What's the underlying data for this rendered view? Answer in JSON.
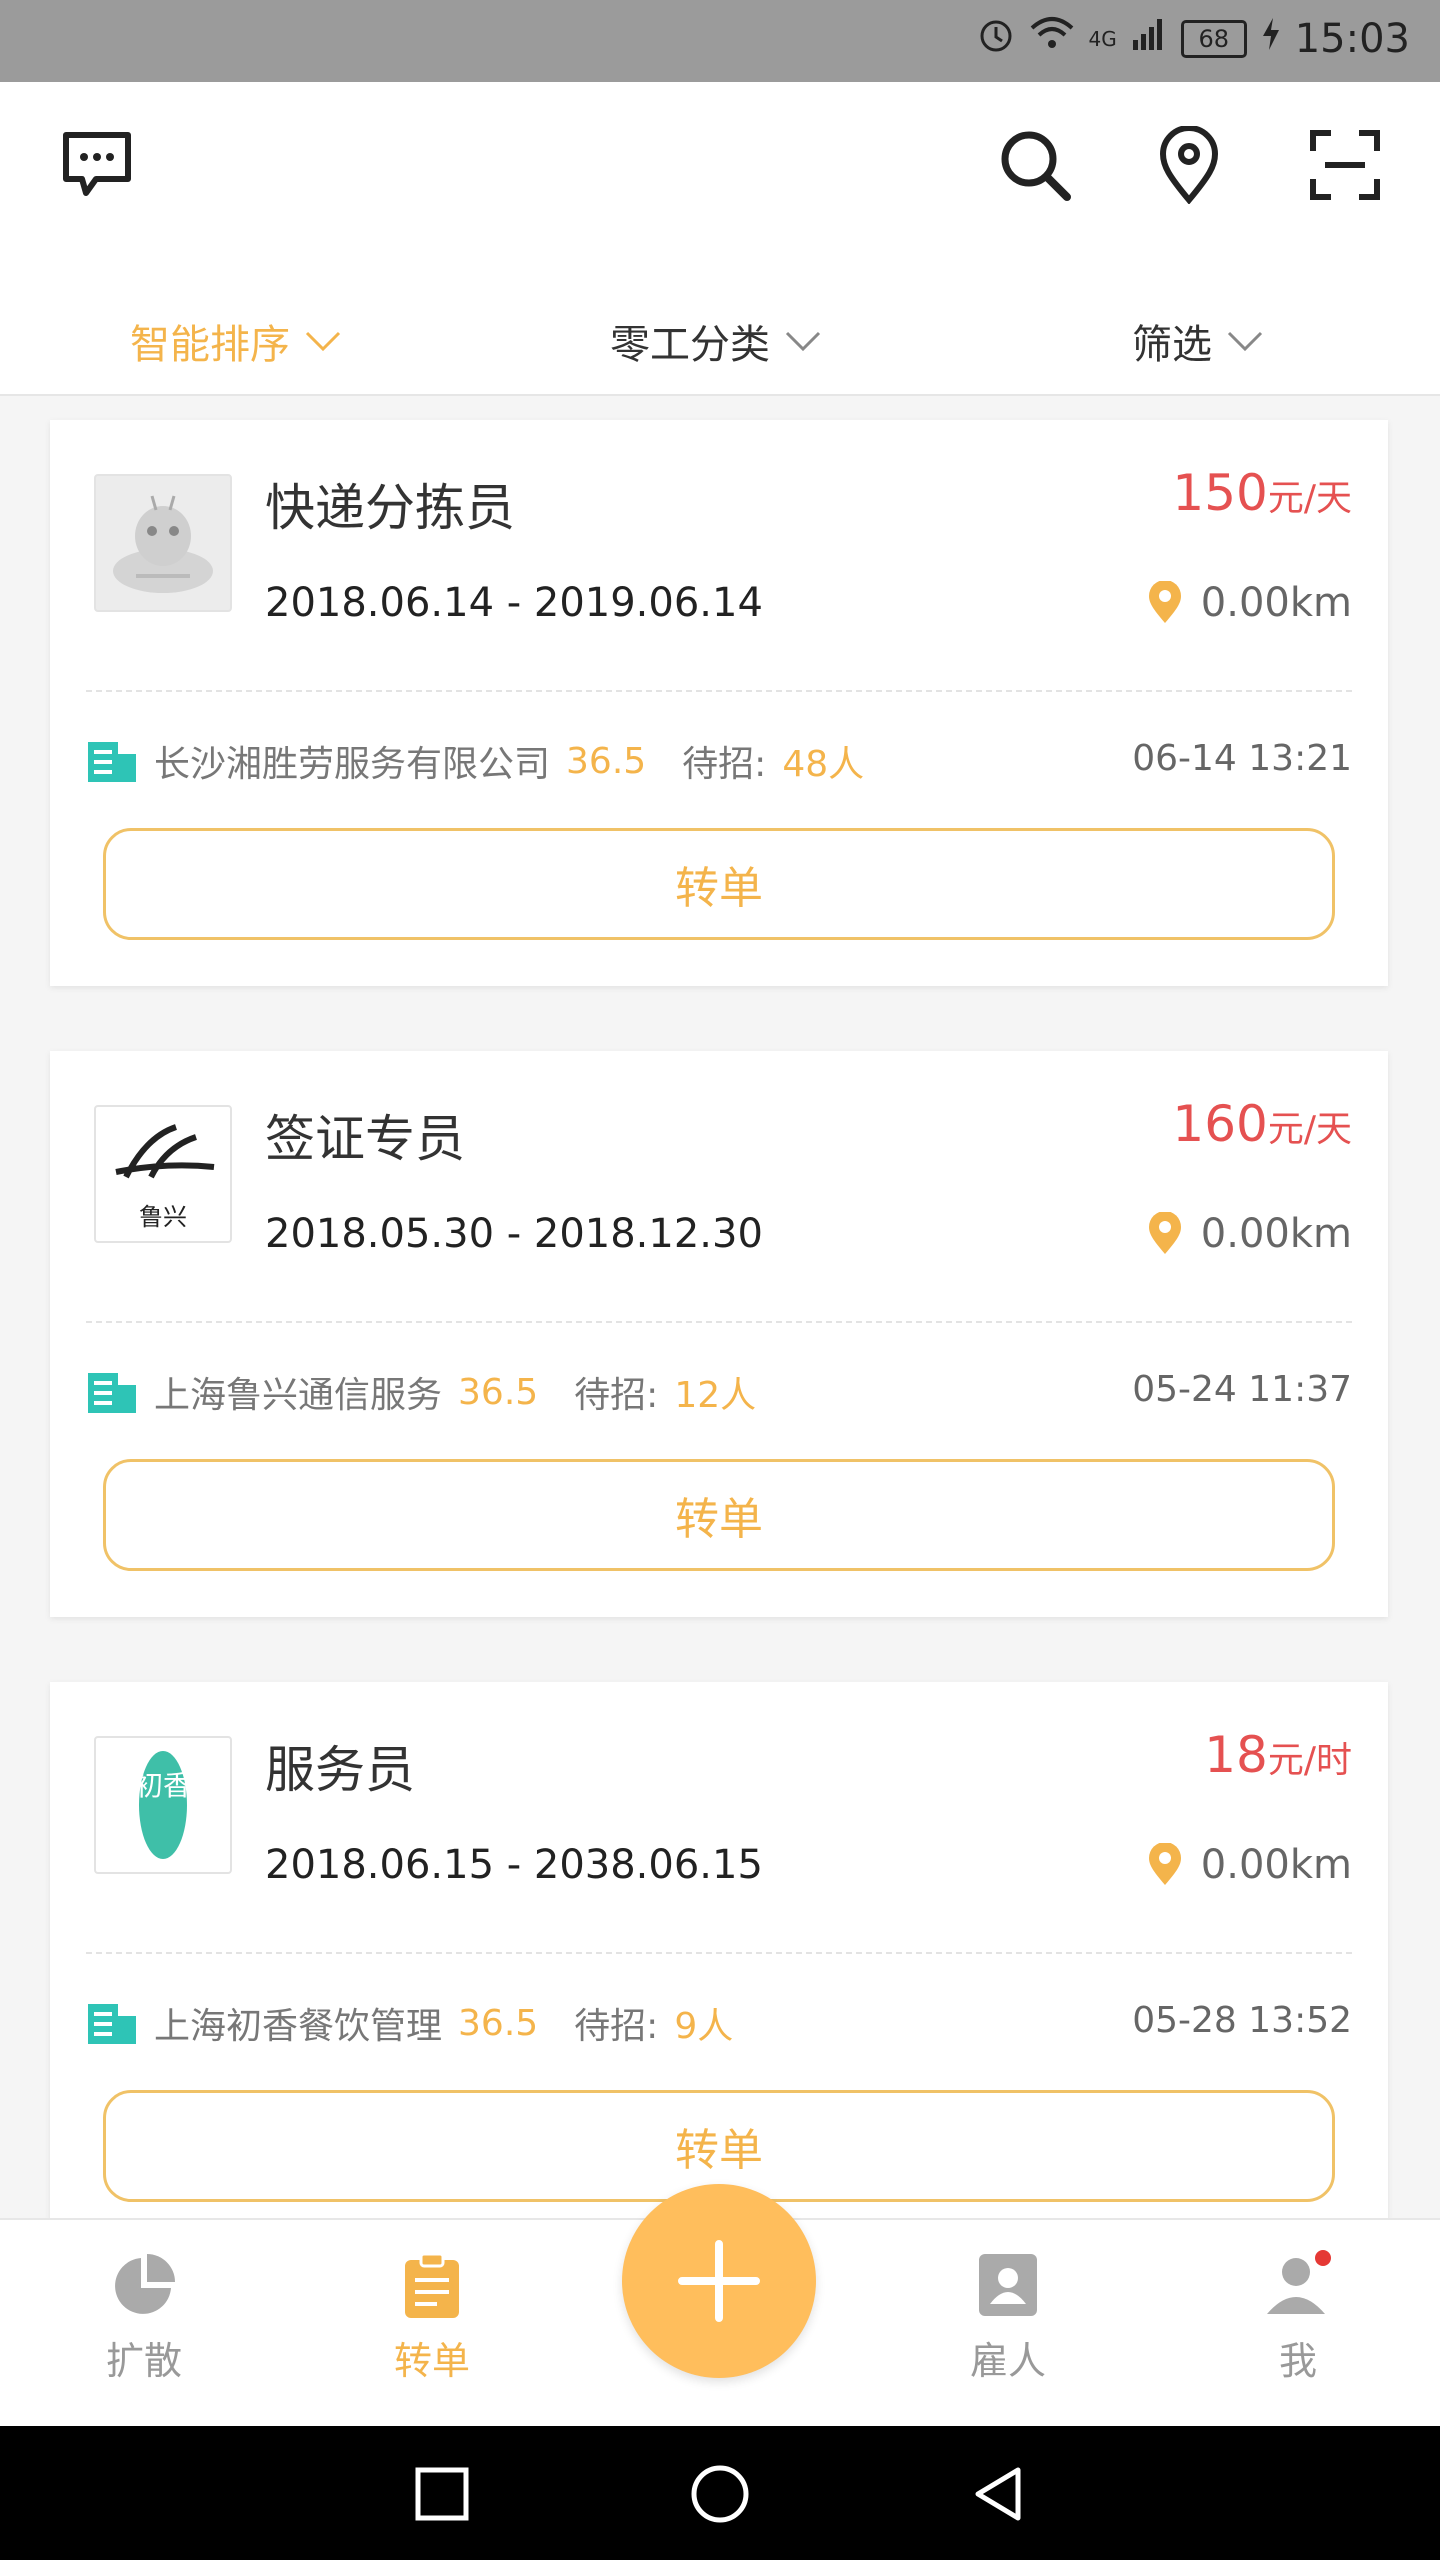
{
  "status_bar": {
    "network": "4G",
    "battery": "68",
    "time": "15:03"
  },
  "header": {
    "icons": [
      "message-icon",
      "search-icon",
      "location-icon",
      "scan-icon"
    ],
    "filters": [
      "智能排序",
      "零工分类",
      "筛选"
    ],
    "active_filter_color": "#f4b44b"
  },
  "jobs": [
    {
      "title": "快递分拣员",
      "dates": "2018.06.14 - 2019.06.14",
      "price": "150",
      "unit": "元/天",
      "distance": "0.00km",
      "company": "长沙湘胜劳服务有限公司",
      "score": "36.5",
      "wait_label": "待招:",
      "count": "48人",
      "time": "06-14 13:21",
      "button": "转单"
    },
    {
      "title": "签证专员",
      "dates": "2018.05.30 - 2018.12.30",
      "price": "160",
      "unit": "元/天",
      "distance": "0.00km",
      "company": "上海鲁兴通信服务",
      "score": "36.5",
      "wait_label": "待招:",
      "count": "12人",
      "time": "05-24 11:37",
      "button": "转单",
      "logo_text": "鲁兴"
    },
    {
      "title": "服务员",
      "dates": "2018.06.15 - 2038.06.15",
      "price": "18",
      "unit": "元/时",
      "distance": "0.00km",
      "company": "上海初香餐饮管理",
      "score": "36.5",
      "wait_label": "待招:",
      "count": "9人",
      "time": "05-28 13:52",
      "button": "转单",
      "logo_text": "初香"
    }
  ],
  "tabbar": {
    "items": [
      "扩散",
      "转单",
      "雇人",
      "我"
    ],
    "active": "转单",
    "active_color": "#f4b44b"
  },
  "colors": {
    "accent": "#ffbe5c",
    "price": "#e55151",
    "teal": "#2ec4b6"
  }
}
